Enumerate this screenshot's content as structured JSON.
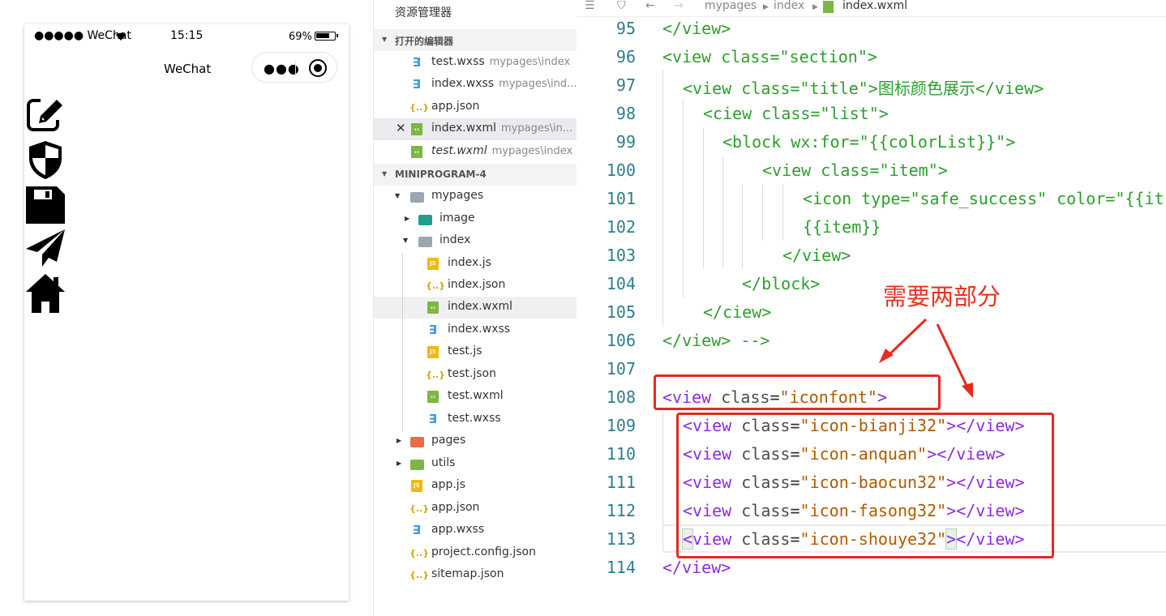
{
  "simulator": {
    "carrier": "●●●●● WeChat",
    "time": "15:15",
    "battery": "69%",
    "nav_title": "WeChat",
    "capsule_more": "●●●",
    "icons": [
      "edit-icon",
      "shield-icon",
      "save-icon",
      "send-icon",
      "home-icon"
    ]
  },
  "explorer": {
    "title": "资源管理器",
    "open_editors_label": "打开的编辑器",
    "open_editors": [
      {
        "name": "test.wxss",
        "path": "mypages\\index",
        "type": "wxss"
      },
      {
        "name": "index.wxss",
        "path": "mypages\\ind...",
        "type": "wxss"
      },
      {
        "name": "app.json",
        "path": "",
        "type": "json"
      },
      {
        "name": "index.wxml",
        "path": "mypages\\in...",
        "type": "wxml",
        "active": true
      },
      {
        "name": "test.wxml",
        "path": "mypages\\index",
        "type": "wxml"
      }
    ],
    "project_label": "MINIPROGRAM-4",
    "tree": [
      {
        "name": "mypages"
      },
      {
        "name": "image"
      },
      {
        "name": "index"
      },
      {
        "name": "index.js"
      },
      {
        "name": "index.json"
      },
      {
        "name": "index.wxml"
      },
      {
        "name": "index.wxss"
      },
      {
        "name": "test.js"
      },
      {
        "name": "test.json"
      },
      {
        "name": "test.wxml"
      },
      {
        "name": "test.wxss"
      },
      {
        "name": "pages"
      },
      {
        "name": "utils"
      },
      {
        "name": "app.js"
      },
      {
        "name": "app.json"
      },
      {
        "name": "app.wxss"
      },
      {
        "name": "project.config.json"
      },
      {
        "name": "sitemap.json"
      }
    ]
  },
  "editor": {
    "breadcrumb": [
      "mypages",
      "index",
      "index.wxml"
    ],
    "lines": [
      {
        "n": "95",
        "text": "</view>"
      },
      {
        "n": "96",
        "text": "<view class=\"section\">"
      },
      {
        "n": "97",
        "text": "<view class=\"title\">图标颜色展示</view>"
      },
      {
        "n": "98",
        "text": "<ciew class=\"list\">"
      },
      {
        "n": "99",
        "text": "<block wx:for=\"{{colorList}}\">"
      },
      {
        "n": "100",
        "text": "<view class=\"item\">"
      },
      {
        "n": "101",
        "text": "<icon type=\"safe_success\" color=\"{{it"
      },
      {
        "n": "102",
        "text": "{{item}}"
      },
      {
        "n": "103",
        "text": "</view>"
      },
      {
        "n": "104",
        "text": "</block>"
      },
      {
        "n": "105",
        "text": "</ciew>"
      },
      {
        "n": "106",
        "text": "</view> -->"
      },
      {
        "n": "107",
        "text": ""
      },
      {
        "n": "108",
        "text": "<view class=\"iconfont\">"
      },
      {
        "n": "109",
        "text": "<view class=\"icon-bianji32\"></view>"
      },
      {
        "n": "110",
        "text": "<view class=\"icon-anquan\"></view>"
      },
      {
        "n": "111",
        "text": "<view class=\"icon-baocun32\"></view>"
      },
      {
        "n": "112",
        "text": "<view class=\"icon-fasong32\"></view>"
      },
      {
        "n": "113",
        "text": "<view class=\"icon-shouye32\"></view>"
      },
      {
        "n": "114",
        "text": "</view>"
      }
    ],
    "annotation": "需要两部分"
  },
  "colors": {
    "annotation_red": "#e52a1e",
    "comment_green": "#2e9e2e",
    "tag_purple": "#8a2be2",
    "string_orange": "#b05a00"
  }
}
